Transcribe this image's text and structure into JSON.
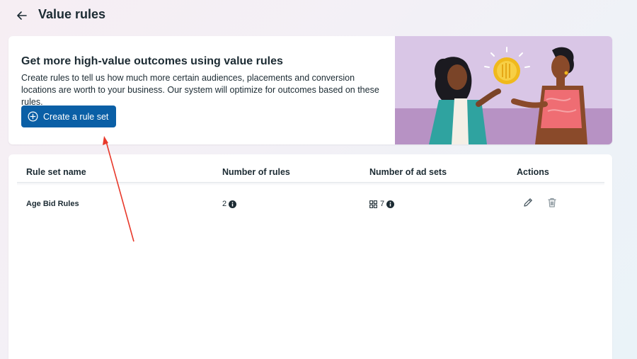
{
  "header": {
    "back_icon": "arrow-left-icon",
    "title": "Value rules"
  },
  "promo": {
    "heading": "Get more high-value outcomes using value rules",
    "body": "Create rules to tell us how much more certain audiences, placements and conversion locations are worth to your business. Our system will optimize for outcomes based on these rules.",
    "create_button_label": "Create a rule set",
    "create_button_icon": "plus-circle-icon",
    "colors": {
      "button": "#0a5fa6",
      "illustration_bg": "#d9c6e6"
    }
  },
  "table": {
    "columns": [
      "Rule set name",
      "Number of rules",
      "Number of ad sets",
      "Actions"
    ],
    "rows": [
      {
        "name": "Age Bid Rules",
        "num_rules": "2",
        "num_ad_sets": "7",
        "actions": [
          "pencil-icon",
          "trash-icon"
        ]
      }
    ]
  },
  "annotation": {
    "color": "#e8392b",
    "target": "create-rule-set-button"
  }
}
